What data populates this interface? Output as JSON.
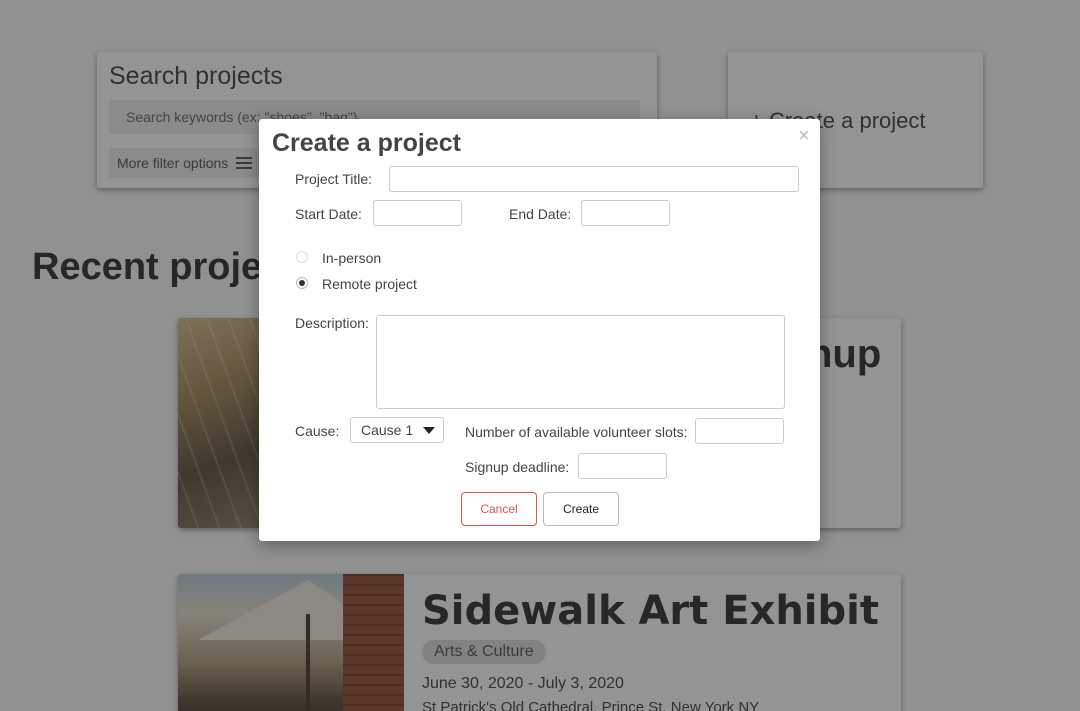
{
  "search": {
    "title": "Search projects",
    "placeholder": "Search keywords (ex: \"shoes\", \"bag\")",
    "filter_label": "More filter options"
  },
  "create_card": {
    "label": "+ Create a project"
  },
  "recent": {
    "title": "Recent projects",
    "project1": {
      "title_visible": "nup"
    },
    "project2": {
      "title": "Sidewalk Art Exhibit",
      "tag": "Arts & Culture",
      "dates": "June 30, 2020 - July 3, 2020",
      "location": "St Patrick's Old Cathedral, Prince St, New York NY"
    }
  },
  "modal": {
    "title": "Create a project",
    "close": "×",
    "project_title_label": "Project Title:",
    "project_title_value": "",
    "start_date_label": "Start Date:",
    "start_date_value": "",
    "end_date_label": "End Date:",
    "end_date_value": "",
    "radio_in_person": "In-person",
    "radio_remote": "Remote project",
    "selected_mode": "Remote project",
    "description_label": "Description:",
    "description_value": "",
    "cause_label": "Cause:",
    "cause_value": "Cause 1",
    "slots_label": "Number of available volunteer slots:",
    "slots_value": "",
    "deadline_label": "Signup deadline:",
    "deadline_value": "",
    "cancel_label": "Cancel",
    "create_label": "Create"
  }
}
